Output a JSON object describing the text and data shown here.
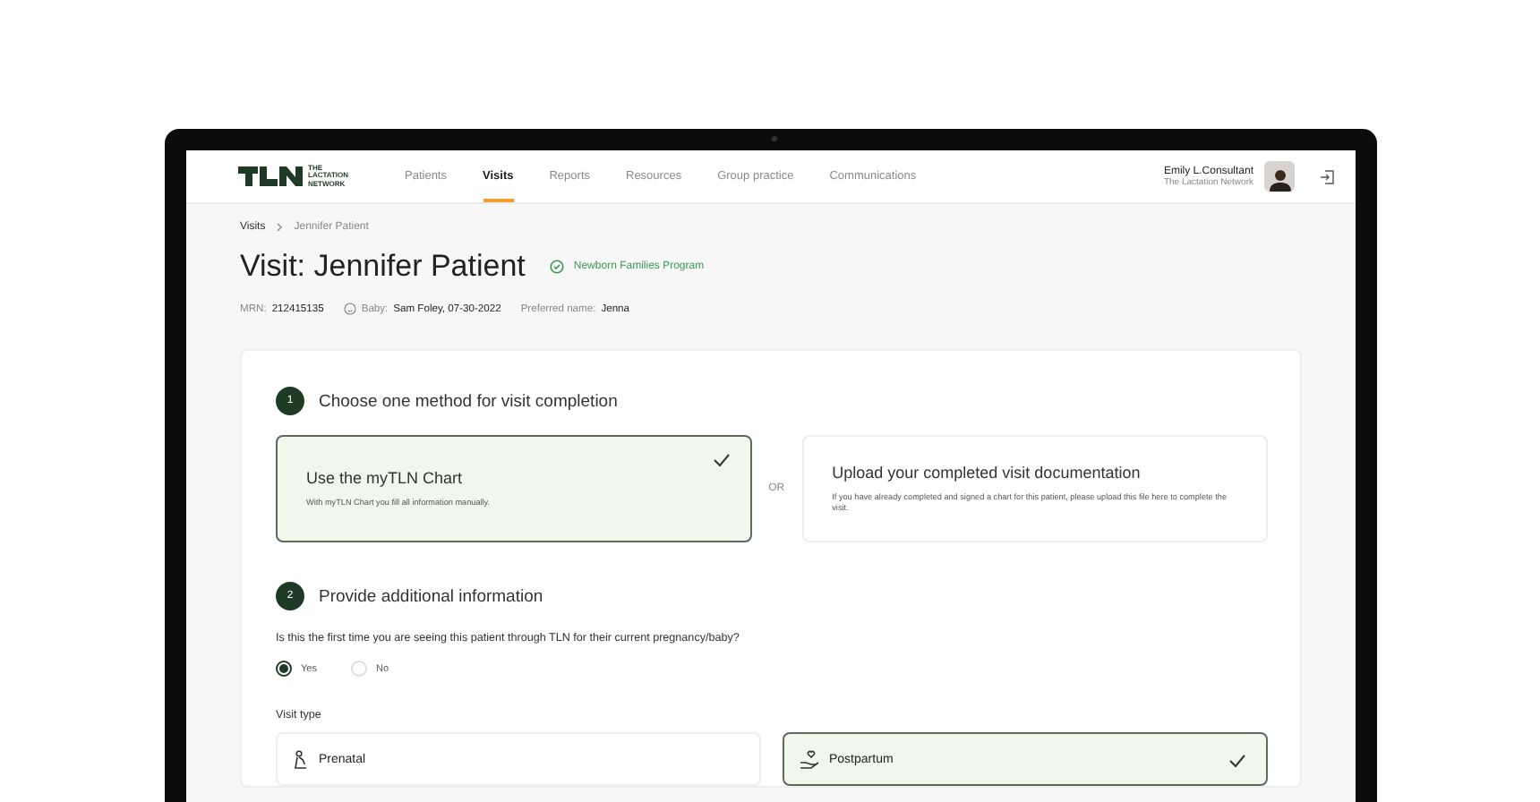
{
  "logo": {
    "text": "THE LACTATION NETWORK"
  },
  "nav": [
    {
      "label": "Patients",
      "selected": false
    },
    {
      "label": "Visits",
      "selected": true
    },
    {
      "label": "Reports",
      "selected": false
    },
    {
      "label": "Resources",
      "selected": false
    },
    {
      "label": "Group practice",
      "selected": false
    },
    {
      "label": "Communications",
      "selected": false
    }
  ],
  "user": {
    "name": "Emily L.Consultant",
    "organization": "The Lactation Network"
  },
  "breadcrumb": [
    "Visits",
    "Jennifer Patient"
  ],
  "title": "Visit: Jennifer Patient",
  "program": "Newborn Families Program",
  "meta": [
    {
      "label": "MRN:",
      "value": "212415135",
      "kind": "plain"
    },
    {
      "label": "Baby:",
      "value": "Sam Foley, 07-30-2022",
      "kind": "baby"
    },
    {
      "label": "Preferred name:",
      "value": "Jenna",
      "kind": "plain"
    }
  ],
  "step1": {
    "number": "1",
    "title": "Choose one method for visit completion",
    "separator": "OR",
    "options": [
      {
        "title": "Use the myTLN Chart",
        "description": "With myTLN Chart you fill all information manually.",
        "selected": true
      },
      {
        "title": "Upload your completed visit documentation",
        "description": "If you have already completed and signed a chart for this patient, please upload this file here to complete the visit.",
        "selected": false
      }
    ]
  },
  "step2": {
    "number": "2",
    "title": "Provide additional information",
    "question": "Is this the first time you are seeing this patient through TLN for their current pregnancy/baby?",
    "answers": [
      {
        "label": "Yes",
        "selected": true
      },
      {
        "label": "No",
        "selected": false
      }
    ],
    "visit_type_label": "Visit type",
    "visit_types": [
      {
        "label": "Prenatal",
        "kind": "prenatal",
        "selected": false
      },
      {
        "label": "Postpartum",
        "kind": "postpartum",
        "selected": true
      }
    ]
  }
}
